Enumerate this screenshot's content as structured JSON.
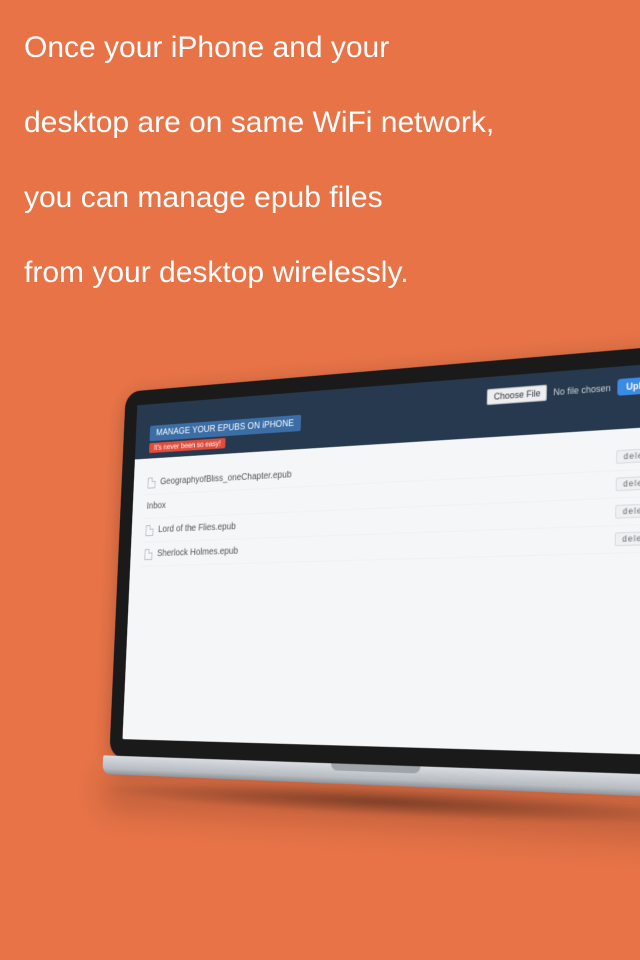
{
  "promo": {
    "line1": "Once your iPhone and your",
    "line2": "desktop are on same WiFi network,",
    "line3": "you can manage epub files",
    "line4": "from your desktop wirelessly."
  },
  "webpage": {
    "title": "MANAGE YOUR EPUBS ON iPHONE",
    "tagline": "It's never been so easy!",
    "choose_label": "Choose File",
    "no_file_label": "No file chosen",
    "upload_label": "Upload",
    "action_label": "delete",
    "files": [
      "GeographyofBliss_oneChapter.epub",
      "Inbox",
      "Lord of the Flies.epub",
      "Sherlock Holmes.epub"
    ]
  }
}
